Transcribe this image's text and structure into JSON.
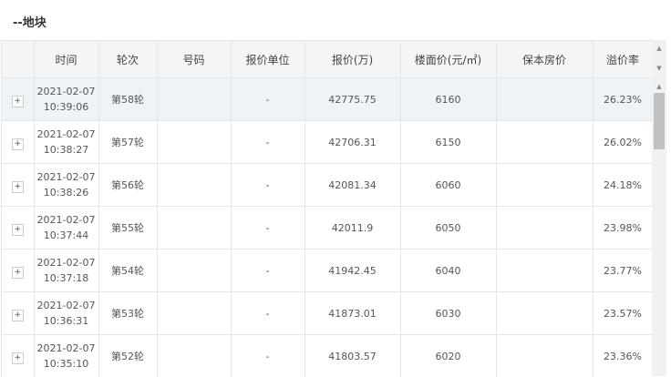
{
  "section": {
    "title": "--地块"
  },
  "table": {
    "columns": [
      "",
      "时间",
      "轮次",
      "号码",
      "报价单位",
      "报价(万)",
      "楼面价(元/㎡)",
      "保本房价",
      "溢价率"
    ],
    "rows": [
      {
        "expand": "+",
        "date": "2021-02-07",
        "time": "10:39:06",
        "round": "第58轮",
        "number": "",
        "bidder": "-",
        "price": "42775.75",
        "floor_price": "6160",
        "breakeven": "",
        "premium": "26.23%"
      },
      {
        "expand": "+",
        "date": "2021-02-07",
        "time": "10:38:27",
        "round": "第57轮",
        "number": "",
        "bidder": "-",
        "price": "42706.31",
        "floor_price": "6150",
        "breakeven": "",
        "premium": "26.02%"
      },
      {
        "expand": "+",
        "date": "2021-02-07",
        "time": "10:38:26",
        "round": "第56轮",
        "number": "",
        "bidder": "-",
        "price": "42081.34",
        "floor_price": "6060",
        "breakeven": "",
        "premium": "24.18%"
      },
      {
        "expand": "+",
        "date": "2021-02-07",
        "time": "10:37:44",
        "round": "第55轮",
        "number": "",
        "bidder": "-",
        "price": "42011.9",
        "floor_price": "6050",
        "breakeven": "",
        "premium": "23.98%"
      },
      {
        "expand": "+",
        "date": "2021-02-07",
        "time": "10:37:18",
        "round": "第54轮",
        "number": "",
        "bidder": "-",
        "price": "41942.45",
        "floor_price": "6040",
        "breakeven": "",
        "premium": "23.77%"
      },
      {
        "expand": "+",
        "date": "2021-02-07",
        "time": "10:36:31",
        "round": "第53轮",
        "number": "",
        "bidder": "-",
        "price": "41873.01",
        "floor_price": "6030",
        "breakeven": "",
        "premium": "23.57%"
      },
      {
        "expand": "+",
        "date": "2021-02-07",
        "time": "10:35:10",
        "round": "第52轮",
        "number": "",
        "bidder": "-",
        "price": "41803.57",
        "floor_price": "6020",
        "breakeven": "",
        "premium": "23.36%"
      }
    ]
  },
  "scrollbar": {
    "up_arrow": "▲",
    "down_arrow": "▼"
  },
  "colors": {
    "header_bg": "#f5f5f5",
    "selected_row_bg": "#eef3f8",
    "border": "#e6e6e6",
    "text": "#555555"
  }
}
